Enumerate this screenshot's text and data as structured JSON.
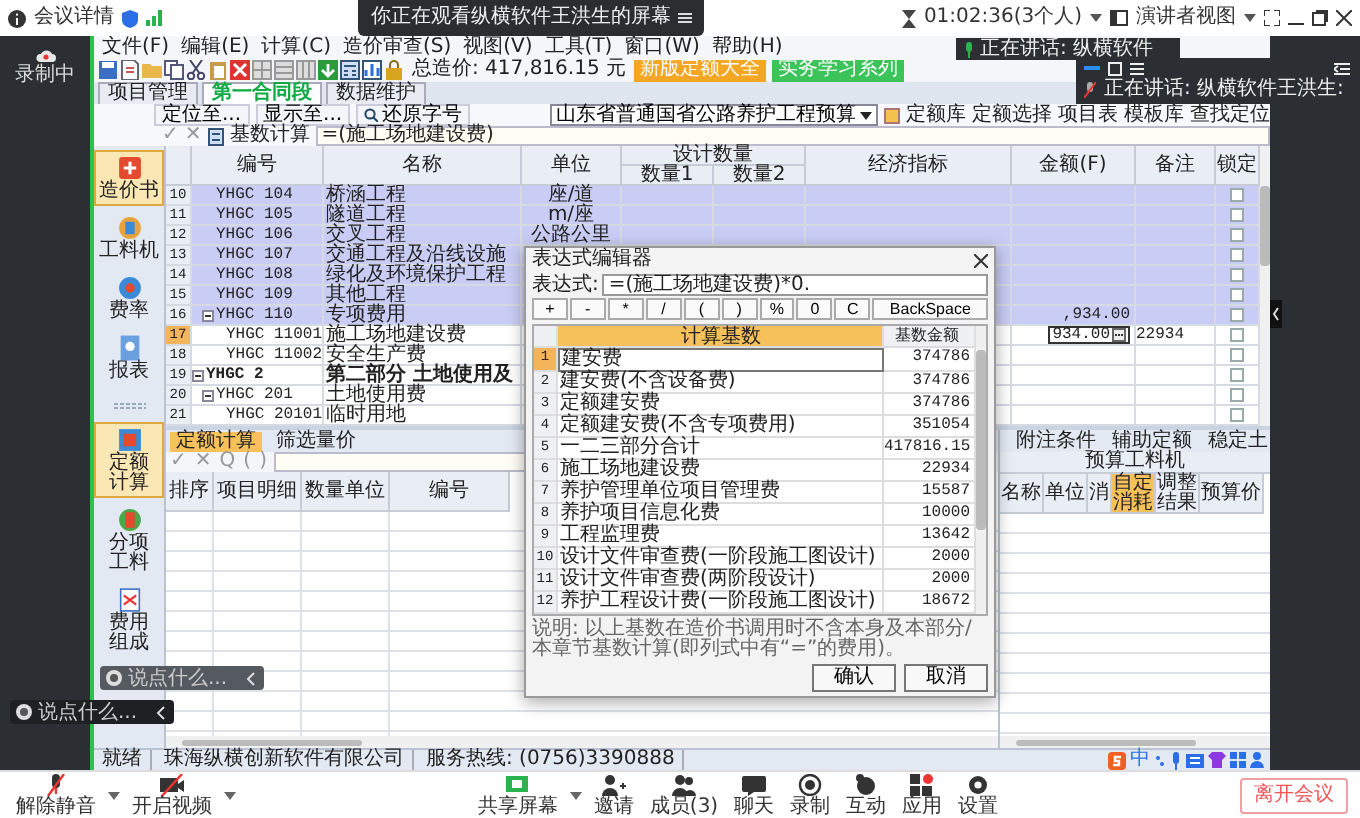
{
  "meeting": {
    "details": "会议详情",
    "banner": "你正在观看纵横软件王洪生的屏幕",
    "timer": "01:02:36(3个人)",
    "view": "演讲者视图",
    "recording": "录制中"
  },
  "speakers": [
    "正在讲话: 纵横软件",
    "正在讲话: 纵横软件王洪生:"
  ],
  "chat_inputs": [
    {
      "placeholder": "说点什么..."
    },
    {
      "placeholder": "说点什么..."
    }
  ],
  "menu": [
    "文件(F)",
    "编辑(E)",
    "计算(C)",
    "造价审查(S)",
    "视图(V)",
    "工具(T)",
    "窗口(W)",
    "帮助(H)"
  ],
  "toolbar": {
    "total": "总造价: 417,816.15 元",
    "buttons": [
      {
        "label": "新版定额大全",
        "color": "#f5a623"
      },
      {
        "label": "实务学习系列",
        "color": "#3cc45a"
      }
    ]
  },
  "doc_tabs": [
    {
      "label": "项目管理",
      "selected": false
    },
    {
      "label": "第一合同段",
      "selected": true
    },
    {
      "label": "数据维护",
      "selected": false
    }
  ],
  "sub_toolbar": {
    "items": [
      "定位至...",
      "显示至...",
      "还原字号"
    ],
    "library": "山东省普通国省公路养护工程预算",
    "links": [
      "定额库",
      "定额选择",
      "项目表",
      "模板库",
      "查找定位"
    ]
  },
  "formula_bar": {
    "tools": [
      "✓",
      "✕"
    ],
    "mode": "基数计算",
    "value": "=(施工场地建设费)"
  },
  "sidebar": {
    "items": [
      {
        "label": "造价书",
        "selected": true
      },
      {
        "label": "工料机",
        "selected": false
      },
      {
        "label": "费率",
        "selected": false
      },
      {
        "label": "报表",
        "selected": false
      }
    ],
    "lower_items": [
      {
        "label": "定额计算",
        "selected": true
      },
      {
        "label": "分项工料",
        "selected": false
      },
      {
        "label": "费用组成",
        "selected": false
      }
    ]
  },
  "table": {
    "columns": [
      {
        "label": "编号"
      },
      {
        "label": "名称"
      },
      {
        "label": "单位"
      },
      {
        "label": "设计数量",
        "children": [
          {
            "label": "数量1"
          },
          {
            "label": "数量2"
          }
        ]
      },
      {
        "label": "经济指标"
      },
      {
        "label": "金额(F)"
      },
      {
        "label": "备注"
      },
      {
        "label": "锁定"
      }
    ],
    "rows": [
      {
        "num": "10",
        "code": "YHGC 104",
        "name": "桥涵工程",
        "unit": "座/道",
        "kind": "item",
        "selected": true,
        "current": false,
        "locked": false
      },
      {
        "num": "11",
        "code": "YHGC 105",
        "name": "隧道工程",
        "unit": "m/座",
        "kind": "item",
        "selected": true,
        "current": false,
        "locked": false
      },
      {
        "num": "12",
        "code": "YHGC 106",
        "name": "交叉工程",
        "unit": "公路公里",
        "kind": "item",
        "selected": true,
        "current": false,
        "locked": false
      },
      {
        "num": "13",
        "code": "YHGC 107",
        "name": "交通工程及沿线设施",
        "kind": "item",
        "selected": true,
        "current": false,
        "locked": false
      },
      {
        "num": "14",
        "code": "YHGC 108",
        "name": "绿化及环境保护工程",
        "kind": "item",
        "selected": true,
        "current": false,
        "locked": false
      },
      {
        "num": "15",
        "code": "YHGC 109",
        "name": "其他工程",
        "kind": "item",
        "selected": true,
        "current": false,
        "locked": false
      },
      {
        "num": "16",
        "code": "YHGC 110",
        "name": "专项费用",
        "amount": ",934.00",
        "kind": "item",
        "selected": true,
        "current": false,
        "locked": false,
        "expanded": true,
        "children": [
          {
            "num": "17",
            "code": "YHGC 11001",
            "name": "施工场地建设费",
            "amount": "934.00",
            "note": "22934",
            "kind": "item",
            "selected": false,
            "current": true,
            "locked": false
          },
          {
            "num": "18",
            "code": "YHGC 11002",
            "name": "安全生产费",
            "kind": "item",
            "selected": false,
            "current": false,
            "locked": false
          }
        ]
      },
      {
        "num": "19",
        "code": "YHGC 2",
        "name": "第二部分 土地使用及",
        "kind": "part",
        "selected": false,
        "current": false,
        "locked": false,
        "expanded": true,
        "children": [
          {
            "num": "20",
            "code": "YHGC 201",
            "name": "土地使用费",
            "kind": "item",
            "selected": false,
            "current": false,
            "locked": false,
            "expanded": true,
            "children": [
              {
                "num": "21",
                "code": "YHGC 20101",
                "name": "临时用地",
                "kind": "item",
                "selected": false,
                "current": false,
                "locked": false
              }
            ]
          }
        ]
      }
    ]
  },
  "lower_left": {
    "tabs": [
      {
        "label": "定额计算",
        "selected": true
      },
      {
        "label": "筛选量价",
        "selected": false
      }
    ],
    "tools": [
      "✓",
      "✕",
      "Q",
      "(",
      ")"
    ],
    "columns": [
      "排序",
      "项目明细",
      "数量单位",
      "编号"
    ]
  },
  "lower_right": {
    "tabs": [
      "附注条件",
      "辅助定额",
      "稳定土"
    ],
    "group": "预算工料机",
    "columns": [
      {
        "label": "名称",
        "selected": false
      },
      {
        "label": "单位",
        "selected": false
      },
      {
        "label": "消",
        "selected": false
      },
      {
        "label": "自定消耗",
        "selected": true
      },
      {
        "label": "调整结果",
        "selected": false
      },
      {
        "label": "预算价",
        "selected": false
      }
    ]
  },
  "status_bar": {
    "texts": [
      "就绪",
      "珠海纵横创新软件有限公司",
      "服务热线: (0756)3390888"
    ],
    "ime": "中"
  },
  "dialog": {
    "title": "表达式编辑器",
    "label": "表达式:",
    "value": "=(施工场地建设费)*0.",
    "keys": [
      "+",
      "-",
      "*",
      "/",
      "(",
      ")",
      "%",
      "0",
      "C",
      "BackSpace"
    ],
    "columns": [
      "计算基数",
      "基数金额"
    ],
    "rows": [
      {
        "num": "1",
        "name": "建安费",
        "amount": "374786",
        "selected": true
      },
      {
        "num": "2",
        "name": "建安费(不含设备费)",
        "amount": "374786",
        "selected": false
      },
      {
        "num": "3",
        "name": "定额建安费",
        "amount": "374786",
        "selected": false
      },
      {
        "num": "4",
        "name": "定额建安费(不含专项费用)",
        "amount": "351054",
        "selected": false
      },
      {
        "num": "5",
        "name": "一二三部分合计",
        "amount": "417816.15",
        "selected": false
      },
      {
        "num": "6",
        "name": "施工场地建设费",
        "amount": "22934",
        "selected": false
      },
      {
        "num": "7",
        "name": "养护管理单位项目管理费",
        "amount": "15587",
        "selected": false
      },
      {
        "num": "8",
        "name": "养护项目信息化费",
        "amount": "10000",
        "selected": false
      },
      {
        "num": "9",
        "name": "工程监理费",
        "amount": "13642",
        "selected": false
      },
      {
        "num": "10",
        "name": "设计文件审查费(一阶段施工图设计)",
        "amount": "2000",
        "selected": false
      },
      {
        "num": "11",
        "name": "设计文件审查费(两阶段设计)",
        "amount": "2000",
        "selected": false
      },
      {
        "num": "12",
        "name": "养护工程设计费(一阶段施工图设计)",
        "amount": "18672",
        "selected": false
      }
    ],
    "note": "说明: 以上基数在造价书调用时不含本身及本部分/本章节基数计算(即列式中有“=”的费用)。",
    "buttons": [
      "确认",
      "取消"
    ]
  },
  "meeting_toolbar": {
    "left": [
      "解除静音",
      "开启视频"
    ],
    "right": [
      "共享屏幕",
      "邀请",
      "成员(3)",
      "聊天",
      "录制",
      "互动",
      "应用",
      "设置"
    ],
    "leave": "离开会议"
  }
}
